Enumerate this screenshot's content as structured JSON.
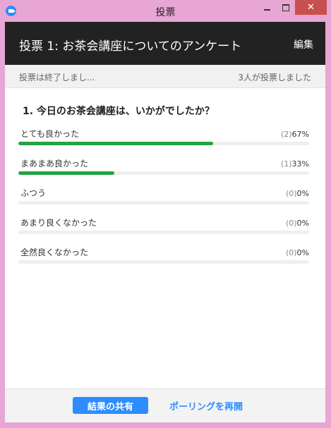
{
  "window": {
    "title": "投票"
  },
  "header": {
    "poll_title": "投票 1: お茶会講座についてのアンケート",
    "edit_label": "編集"
  },
  "status": {
    "left": "投票は終了しまし...",
    "right": "3人が投票しました"
  },
  "question": {
    "text": "1. 今日のお茶会講座は、いかがでしたか？"
  },
  "options": [
    {
      "label": "とても良かった",
      "count": "(2)",
      "percent": "67%",
      "fraction": 0.67
    },
    {
      "label": "まあまあ良かった",
      "count": "(1)",
      "percent": "33%",
      "fraction": 0.33
    },
    {
      "label": "ふつう",
      "count": "(0)",
      "percent": "0%",
      "fraction": 0
    },
    {
      "label": "あまり良くなかった",
      "count": "(0)",
      "percent": "0%",
      "fraction": 0
    },
    {
      "label": "全然良くなかった",
      "count": "(0)",
      "percent": "0%",
      "fraction": 0
    }
  ],
  "footer": {
    "share_label": "結果の共有",
    "repoll_label": "ポーリングを再開"
  },
  "colors": {
    "accent": "#2d8cff",
    "bar_fill": "#23a345",
    "header_bg": "#222222",
    "chrome": "#e8a6d4"
  }
}
